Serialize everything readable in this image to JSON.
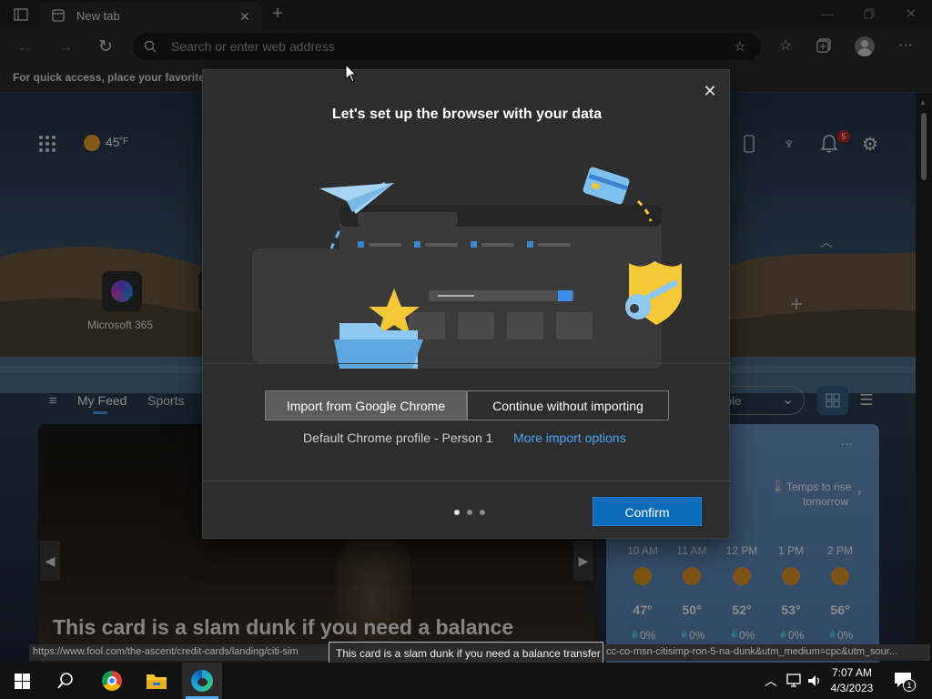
{
  "browser": {
    "tab_title": "New tab",
    "address_placeholder": "Search or enter web address",
    "favorites_hint": "For quick access, place your favorites h"
  },
  "newtab": {
    "temperature": "45",
    "temp_unit": "°F",
    "quicklink_label": "Microsoft 365",
    "notification_count": "5",
    "feed_tabs": [
      "My Feed",
      "Sports"
    ],
    "dropdown_text": "ple",
    "article_title": "This card is a slam dunk if you need a balance",
    "weather_note": [
      "Temps to rise",
      "tomorrow"
    ],
    "more_dots": "···",
    "hourly": [
      {
        "time": "10 AM",
        "temp": "47°",
        "precip": "0%"
      },
      {
        "time": "11 AM",
        "temp": "50°",
        "precip": "0%"
      },
      {
        "time": "12 PM",
        "temp": "52°",
        "precip": "0%"
      },
      {
        "time": "1 PM",
        "temp": "53°",
        "precip": "0%"
      },
      {
        "time": "2 PM",
        "temp": "56°",
        "precip": "0%"
      }
    ]
  },
  "status": {
    "url_left": "https://www.fool.com/the-ascent/credit-cards/landing/citi-sim",
    "url_right": "cc-co-msn-citisimp-ron-5-na-dunk&utm_medium=cpc&utm_sour...",
    "tooltip": "This card is a slam dunk if you need a balance transfer"
  },
  "dialog": {
    "title": "Let's set up the browser with your data",
    "import_button": "Import from Google Chrome",
    "skip_button": "Continue without importing",
    "profile_text": "Default Chrome profile - Person 1",
    "more_options_link": "More import options",
    "confirm_button": "Confirm"
  },
  "taskbar": {
    "time": "7:07 AM",
    "date": "4/3/2023",
    "notification_count": "1"
  },
  "colors": {
    "accent": "#0f6cbd",
    "link": "#4ca3f5",
    "badge": "#c42b1c"
  }
}
